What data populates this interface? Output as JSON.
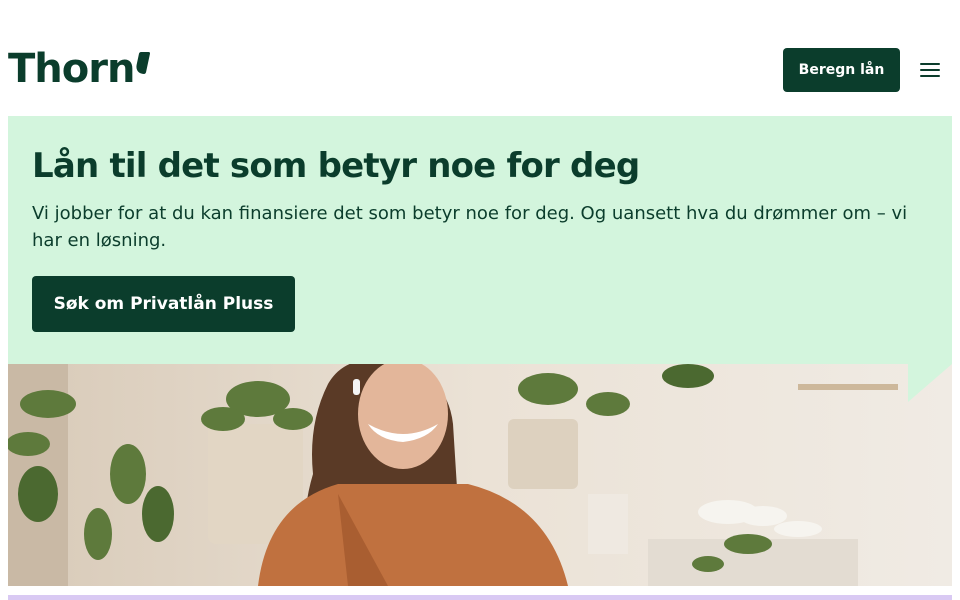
{
  "header": {
    "logo": "Thorn",
    "cta_label": "Beregn lån",
    "menu_icon": "hamburger-icon"
  },
  "hero": {
    "title": "Lån til det som betyr noe for deg",
    "text": "Vi jobber for at du kan finansiere det som betyr noe for deg. Og uansett hva du drømmer om – vi har en løsning.",
    "cta_label": "Søk om Privatlån Pluss",
    "background": "#d3f5dd"
  },
  "image": {
    "icon": "photo-woman-with-plants"
  },
  "colors": {
    "brand": "#0b3d2c",
    "accent_light": "#d3f5dd",
    "lavender": "#d9c9f3"
  }
}
